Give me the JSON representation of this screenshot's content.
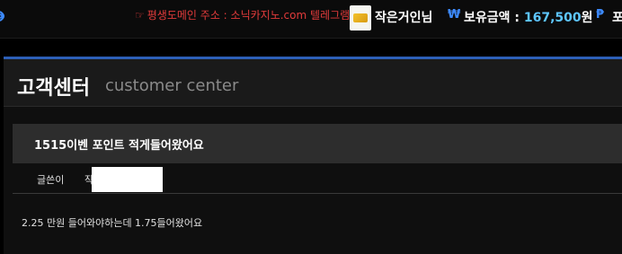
{
  "topbar": {
    "notice_icon": "hand-pointing-icon",
    "notice_text": "평생도메인 주소 : 소닉카지노.com 텔레그램:",
    "nickname": "작은거인님",
    "currency_icon": "₩",
    "balance_label": "보유금액 : ",
    "balance_amount": "167,500",
    "balance_unit": "원",
    "point_icon": "₱",
    "point_label": "포"
  },
  "panel": {
    "title": "고객센터",
    "subtitle": "customer center"
  },
  "post": {
    "title": "1515이벤 포인트 적게들어왔어요",
    "author_label": "글쓴이",
    "date_label_partial": "작",
    "body": "2.25 만원 들어와야하는데 1.75들어왔어요"
  },
  "colors": {
    "accent_blue": "#2d5fb8",
    "notice_red": "#e23b3b",
    "amount_cyan": "#5ec6ff"
  }
}
